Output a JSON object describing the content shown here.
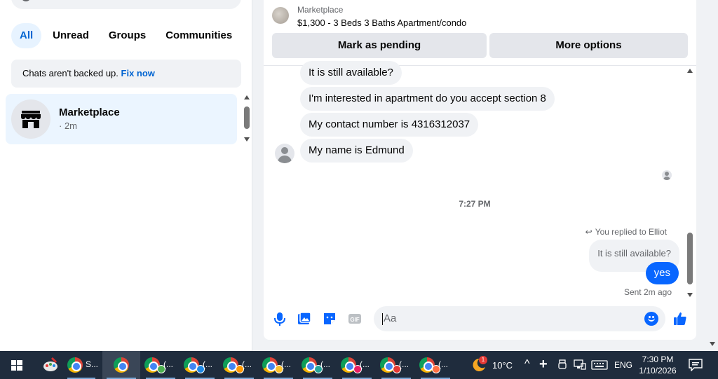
{
  "left": {
    "filters": [
      "All",
      "Unread",
      "Groups",
      "Communities"
    ],
    "notice": {
      "text": "Chats aren't backed up.",
      "link": "Fix now"
    },
    "chat": {
      "name": "Marketplace",
      "time": "· 2m"
    }
  },
  "header": {
    "source": "Marketplace",
    "listing": "$1,300 - 3 Beds 3 Baths Apartment/condo",
    "pending_label": "Mark as pending",
    "more_label": "More options"
  },
  "messages": {
    "incoming": [
      "It is still available?",
      "I'm interested in apartment do you accept section 8",
      "My contact number is 4316312037",
      "My name is Edmund"
    ],
    "timestamp": "7:27 PM",
    "replied_to": "You replied to Elliot",
    "quoted": "It is still available?",
    "outgoing": "yes",
    "status": "Sent 2m ago"
  },
  "composer": {
    "placeholder": "Aa"
  },
  "taskbar": {
    "first_app_label": "S...",
    "chrome_label": "(...",
    "notification_count": "1",
    "temperature": "10°C",
    "language": "ENG",
    "time": "7:30 PM",
    "date": "1/10/2026"
  },
  "colors": {
    "accent": "#0866ff",
    "link": "#0064d1",
    "taskbar": "#1f2c3d"
  }
}
